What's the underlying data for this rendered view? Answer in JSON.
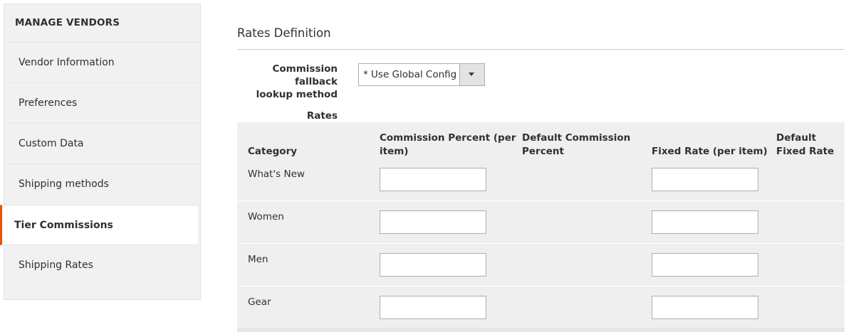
{
  "sidebar": {
    "title": "MANAGE VENDORS",
    "items": [
      {
        "label": "Vendor Information"
      },
      {
        "label": "Preferences"
      },
      {
        "label": "Custom Data"
      },
      {
        "label": "Shipping methods"
      },
      {
        "label": "Tier Commissions",
        "active": true
      },
      {
        "label": "Shipping Rates"
      }
    ]
  },
  "section": {
    "title": "Rates Definition",
    "fallback_label_line1": "Commission fallback",
    "fallback_label_line2": "lookup method",
    "fallback_value": "* Use Global Config",
    "rates_label": "Rates"
  },
  "table": {
    "headers": {
      "category": "Category",
      "commission_percent_1": "Commission Percent (per",
      "commission_percent_2": "item)",
      "default_commission_1": "Default Commission",
      "default_commission_2": "Percent",
      "fixed_rate": "Fixed Rate (per item)",
      "default_fixed_1": "Default",
      "default_fixed_2": "Fixed Rate"
    },
    "rows": [
      {
        "category": "What's New",
        "commission_percent": "",
        "fixed_rate": ""
      },
      {
        "category": "Women",
        "commission_percent": "",
        "fixed_rate": ""
      },
      {
        "category": "Men",
        "commission_percent": "",
        "fixed_rate": ""
      },
      {
        "category": "Gear",
        "commission_percent": "",
        "fixed_rate": ""
      }
    ]
  },
  "colors": {
    "accent": "#eb5202",
    "sidebar_bg": "#f1f1f1",
    "grid_bg": "#efefef"
  }
}
